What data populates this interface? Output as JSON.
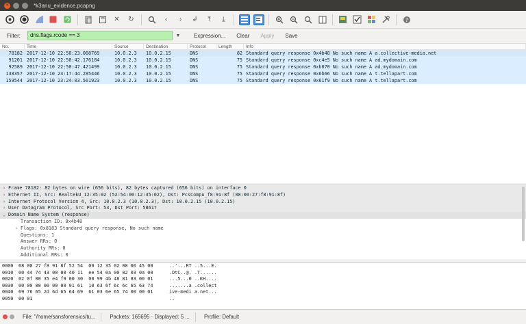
{
  "window": {
    "title": "*k3anu_evidence.pcapng"
  },
  "filter": {
    "label": "Filter:",
    "value": "dns.flags.rcode == 3",
    "expression_label": "Expression...",
    "clear_label": "Clear",
    "apply_label": "Apply",
    "save_label": "Save"
  },
  "packet_list": {
    "columns": [
      "No.",
      "Time",
      "Source",
      "Destination",
      "Protocol",
      "Length",
      "Info"
    ],
    "rows": [
      {
        "no": "78182",
        "time": "2017-12-10 22:50:23.068769",
        "src": "10.0.2.3",
        "dst": "10.0.2.15",
        "proto": "DNS",
        "len": "82",
        "info": "Standard query response 0x4b48 No such name A a.collective-media.net"
      },
      {
        "no": "91201",
        "time": "2017-12-10 22:50:42.176184",
        "src": "10.0.2.3",
        "dst": "10.0.2.15",
        "proto": "DNS",
        "len": "75",
        "info": "Standard query response 0xc4e5 No such name A ad.mydomain.com"
      },
      {
        "no": "92589",
        "time": "2017-12-10 22:50:47.421499",
        "src": "10.0.2.3",
        "dst": "10.0.2.15",
        "proto": "DNS",
        "len": "75",
        "info": "Standard query response 0xb070 No such name A ad.mydomain.com"
      },
      {
        "no": "138357",
        "time": "2017-12-10 23:17:44.285446",
        "src": "10.0.2.3",
        "dst": "10.0.2.15",
        "proto": "DNS",
        "len": "75",
        "info": "Standard query response 0x6b66 No such name A t.tellapart.com"
      },
      {
        "no": "159544",
        "time": "2017-12-10 23:24:03.561923",
        "src": "10.0.2.3",
        "dst": "10.0.2.15",
        "proto": "DNS",
        "len": "75",
        "info": "Standard query response 0x61f9 No such name A t.tellapart.com"
      }
    ]
  },
  "details": {
    "rows": [
      {
        "arrow": "›",
        "text": "Frame 78182: 82 bytes on wire (656 bits), 82 bytes captured (656 bits) on interface 0",
        "level": 0
      },
      {
        "arrow": "›",
        "text": "Ethernet II, Src: RealtekU_12:35:02 (52:54:00:12:35:02), Dst: PcsCompu_f8:91:8f (08:00:27:f8:91:8f)",
        "level": 0
      },
      {
        "arrow": "›",
        "text": "Internet Protocol Version 4, Src: 10.0.2.3 (10.0.2.3), Dst: 10.0.2.15 (10.0.2.15)",
        "level": 0
      },
      {
        "arrow": "›",
        "text": "User Datagram Protocol, Src Port: 53, Dst Port: 58617",
        "level": 0
      },
      {
        "arrow": "⌄",
        "text": "Domain Name System (response)",
        "level": 0
      },
      {
        "arrow": "",
        "text": "Transaction ID: 0x4b48",
        "level": 1
      },
      {
        "arrow": "›",
        "text": "Flags: 0x8183 Standard query response, No such name",
        "level": 1
      },
      {
        "arrow": "",
        "text": "Questions: 1",
        "level": 1
      },
      {
        "arrow": "",
        "text": "Answer RRs: 0",
        "level": 1
      },
      {
        "arrow": "",
        "text": "Authority RRs: 0",
        "level": 1
      },
      {
        "arrow": "",
        "text": "Additional RRs: 0",
        "level": 1
      }
    ]
  },
  "hex": {
    "rows": [
      {
        "off": "0000",
        "bytes": "08 00 27 f8 91 8f 52 54  00 12 35 02 08 00 45 00",
        "ascii": "..'...RT ..5...E."
      },
      {
        "off": "0010",
        "bytes": "00 44 74 43 00 00 40 11  ee 54 0a 00 02 03 0a 00",
        "ascii": ".DtC..@. .T......"
      },
      {
        "off": "0020",
        "bytes": "02 0f 00 35 e4 f9 00 30  00 99 4b 48 81 83 00 01",
        "ascii": "...5...0 ..KH...."
      },
      {
        "off": "0030",
        "bytes": "00 00 00 00 00 00 01 61  10 63 6f 6c 6c 65 63 74",
        "ascii": ".......a .collect"
      },
      {
        "off": "0040",
        "bytes": "69 76 65 2d 6d 65 64 69  61 03 6e 65 74 00 00 01",
        "ascii": "ive-medi a.net..."
      },
      {
        "off": "0050",
        "bytes": "00 01",
        "ascii": ".."
      }
    ]
  },
  "status": {
    "file": "File: \"/home/sansforensics/tu...",
    "packets": "Packets: 165695 · Displayed: 5 ...",
    "profile": "Profile: Default"
  },
  "colors": {
    "filter_valid": "#b8f0b0",
    "row_bg": "#daeeff",
    "accent": "#4a90d9"
  }
}
